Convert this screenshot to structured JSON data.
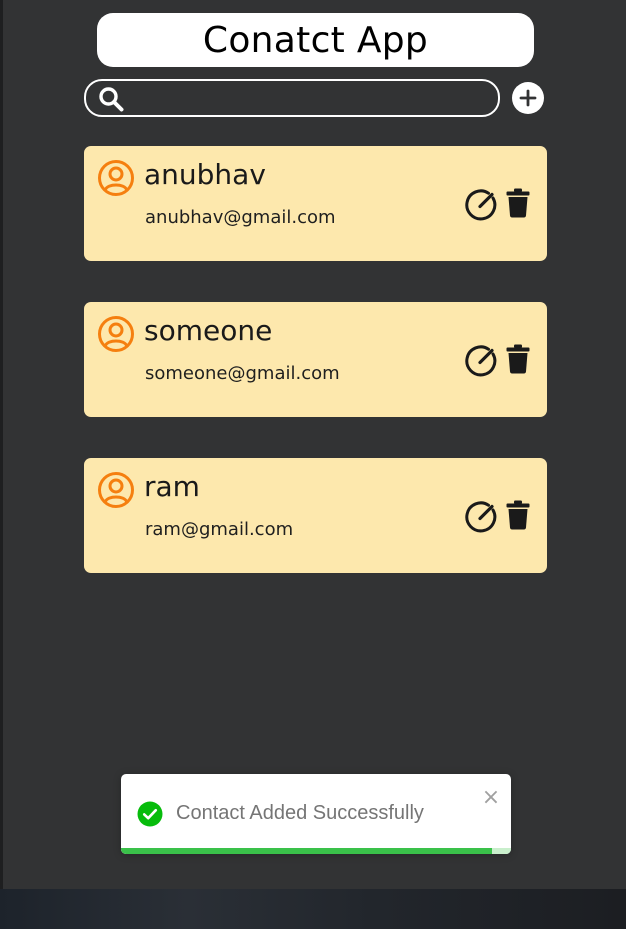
{
  "header": {
    "title": "Conatct App"
  },
  "search": {
    "placeholder": "",
    "value": ""
  },
  "add_button": {
    "icon": "plus-circle-icon"
  },
  "contacts": [
    {
      "name": "anubhav",
      "email": "anubhav@gmail.com"
    },
    {
      "name": "someone",
      "email": "someone@gmail.com"
    },
    {
      "name": "ram",
      "email": "ram@gmail.com"
    }
  ],
  "card_icons": {
    "avatar": "user-circle-icon",
    "edit": "edit-icon",
    "delete": "trash-icon"
  },
  "toast": {
    "message": "Contact Added Successfully",
    "close_glyph": "×",
    "progress": 0.95
  },
  "colors": {
    "background": "#323334",
    "card": "#fde8ad",
    "avatar": "#f57f0f",
    "success": "#3ac14a"
  }
}
